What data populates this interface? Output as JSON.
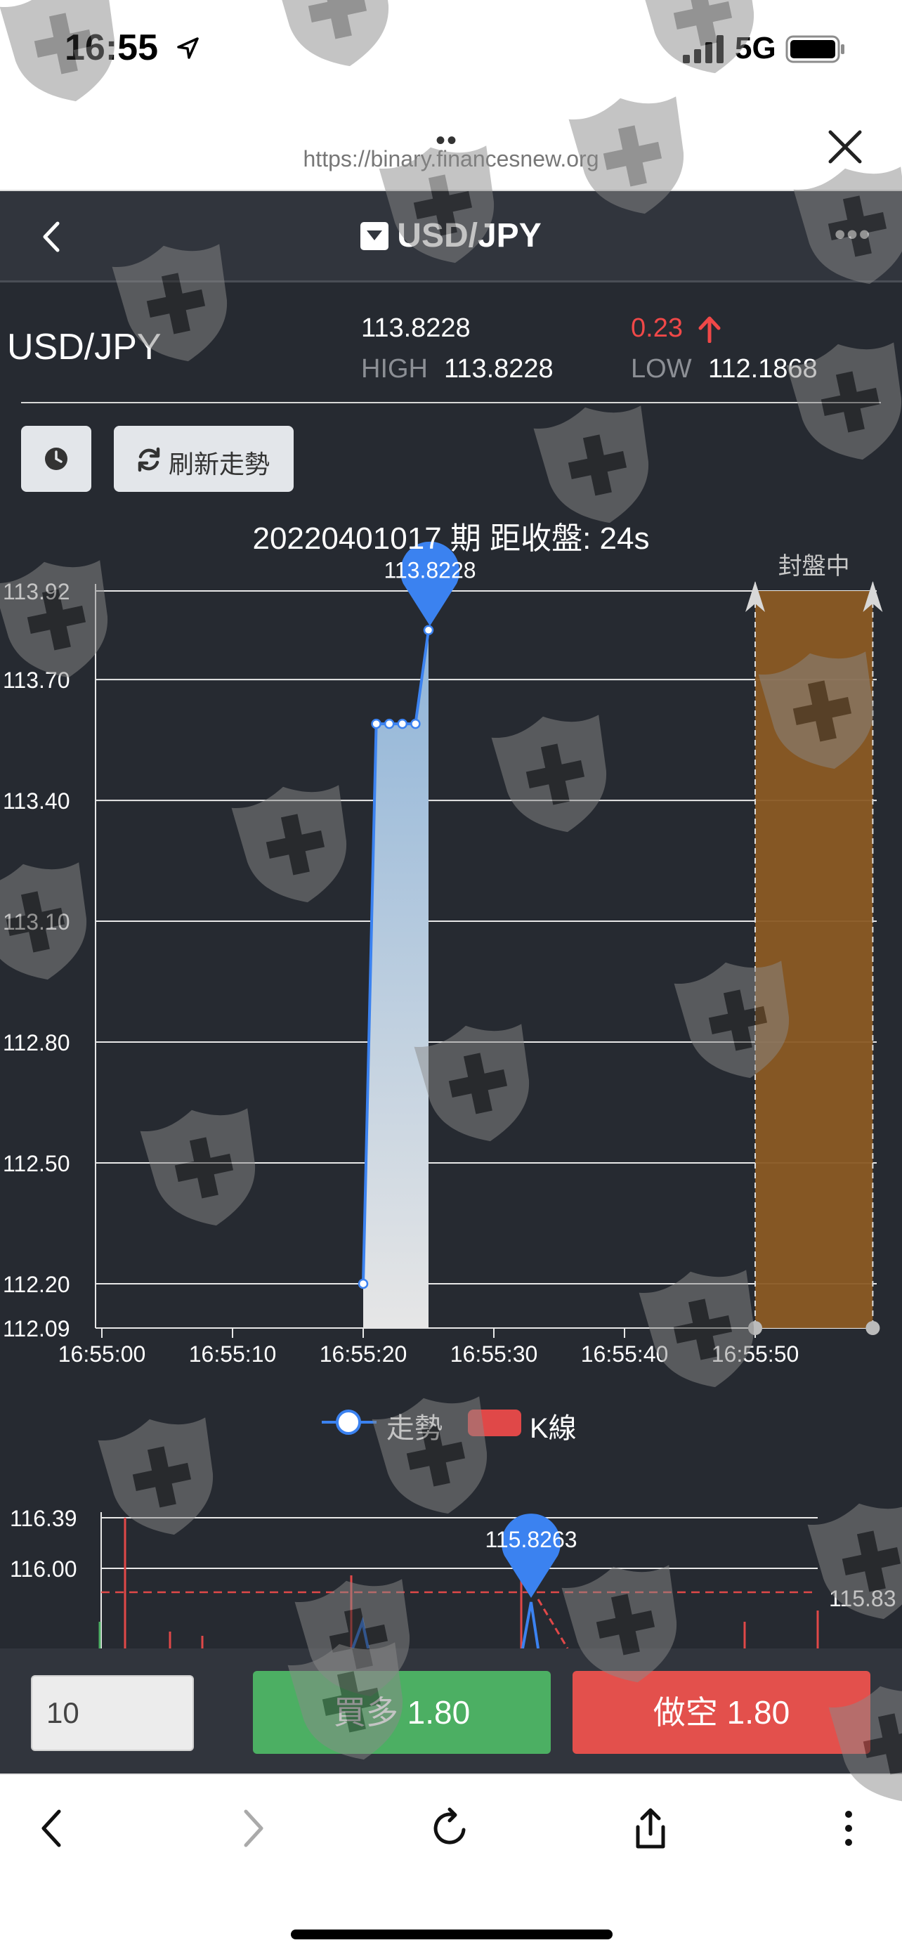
{
  "status_bar": {
    "time": "16:55",
    "network": "5G"
  },
  "browser": {
    "url": "https://binary.financesnew.org",
    "dots": "••"
  },
  "nav": {
    "title": "USD/JPY"
  },
  "quote": {
    "symbol": "USD/JPY",
    "last": "113.8228",
    "high_label": "HIGH",
    "high": "113.8228",
    "change": "0.23",
    "low_label": "LOW",
    "low": "112.1868"
  },
  "controls": {
    "refresh_label": "刷新走勢"
  },
  "period": "20220401017 期 距收盤: 24s",
  "legend": {
    "trend": "走勢",
    "kline": "K線"
  },
  "chart_data": [
    {
      "type": "area",
      "y_ticks": [
        "113.92",
        "113.70",
        "113.40",
        "113.10",
        "112.80",
        "112.50",
        "112.20",
        "112.09"
      ],
      "x_ticks": [
        "16:55:00",
        "16:55:10",
        "16:55:20",
        "16:55:30",
        "16:55:40",
        "16:55:50"
      ],
      "ylim": [
        112.09,
        113.92
      ],
      "series": [
        {
          "name": "走勢",
          "points": [
            {
              "t": 20,
              "v": 112.2
            },
            {
              "t": 21,
              "v": 113.59
            },
            {
              "t": 22,
              "v": 113.59
            },
            {
              "t": 23,
              "v": 113.59
            },
            {
              "t": 24,
              "v": 113.59
            },
            {
              "t": 25,
              "v": 113.8228
            }
          ]
        }
      ],
      "marker_label": "113.8228",
      "closed_zone_label": "封盤中",
      "closed_zone": [
        50,
        59
      ],
      "grid": true,
      "legend_placement": "bottom"
    },
    {
      "type": "line",
      "y_ticks": [
        "116.39",
        "116.00"
      ],
      "marker_label": "115.8263",
      "ref_line_label": "115.83"
    }
  ],
  "trade": {
    "amount": "10",
    "buy_label": "買多 1.80",
    "sell_label": "做空 1.80"
  },
  "colors": {
    "background": "#262a31",
    "navbar": "#31353d",
    "trend_line": "#3b82f0",
    "closed_zone": "#8a5a24",
    "buy": "#4caf63",
    "sell": "#e3504c",
    "up": "#f04848"
  }
}
